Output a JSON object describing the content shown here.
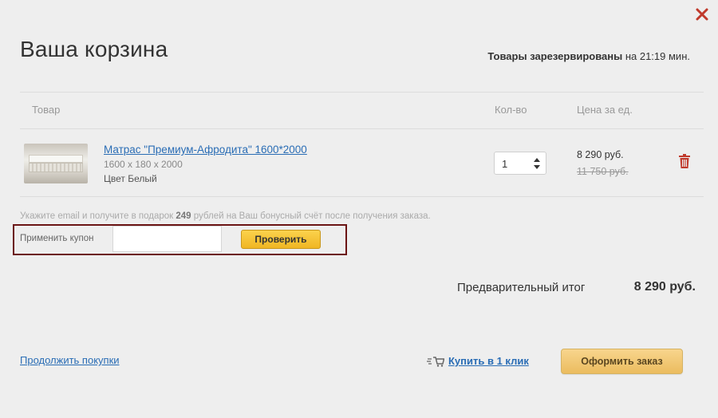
{
  "modal": {
    "title": "Ваша корзина",
    "reserve_bold": "Товары зарезервированы",
    "reserve_rest": " на 21:19 мин."
  },
  "table": {
    "col_product": "Товар",
    "col_qty": "Кол-во",
    "col_price": "Цена за ед."
  },
  "item": {
    "name": "Матрас \"Премиум-Афродита\" 1600*2000",
    "size": "1600 x 180 x 2000",
    "color": "Цвет Белый",
    "quantity": "1",
    "price": "8 290 руб.",
    "old_price": "11 750 руб."
  },
  "bonus_note": {
    "before": "Укажите email и получите в подарок ",
    "amount": "249",
    "after": " рублей на Ваш бонусный счёт после получения заказа."
  },
  "coupon": {
    "label": "Применить купон",
    "value": "",
    "button": "Проверить"
  },
  "summary": {
    "label": "Предварительный итог",
    "value": "8 290 руб."
  },
  "footer": {
    "continue": "Продолжить покупки",
    "one_click": "Купить в 1 клик",
    "order": "Оформить заказ"
  },
  "colors": {
    "link": "#2a6db5",
    "close": "#c0392b",
    "trash": "#c0392b",
    "highlight_border": "#6b1414",
    "check_button": "#f0b623",
    "order_button": "#ebbc5f"
  },
  "icons": [
    "close-icon",
    "spinner-arrows-icon",
    "trash-icon",
    "cart-one-click-icon"
  ]
}
